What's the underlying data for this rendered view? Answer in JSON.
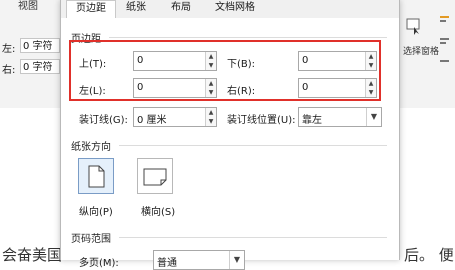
{
  "ribbon": {
    "view_label": "视图",
    "indent_left_label": "左:",
    "indent_right_label": "右:",
    "indent_left_value": "0 字符",
    "indent_right_value": "0 字符",
    "selection_pane_label": "选择窗格"
  },
  "document": {
    "line_left": "会奋美国",
    "line_right": "后。 便"
  },
  "dialog": {
    "tabs": [
      {
        "label": "页边距",
        "active": true
      },
      {
        "label": "纸张",
        "active": false
      },
      {
        "label": "布局",
        "active": false
      },
      {
        "label": "文档网格",
        "active": false
      }
    ],
    "margins": {
      "section_title": "页边距",
      "top_label": "上(T):",
      "top_value": "0",
      "bottom_label": "下(B):",
      "bottom_value": "0",
      "left_label": "左(L):",
      "left_value": "0",
      "right_label": "右(R):",
      "right_value": "0",
      "gutter_label": "装订线(G):",
      "gutter_value": "0 厘米",
      "gutter_pos_label": "装订线位置(U):",
      "gutter_pos_value": "靠左"
    },
    "orientation": {
      "section_title": "纸张方向",
      "portrait_label": "纵向(P)",
      "landscape_label": "横向(S)"
    },
    "pages": {
      "section_title": "页码范围",
      "multiple_label": "多页(M):",
      "multiple_value": "普通"
    }
  },
  "colors": {
    "highlight": "#e0302a"
  }
}
